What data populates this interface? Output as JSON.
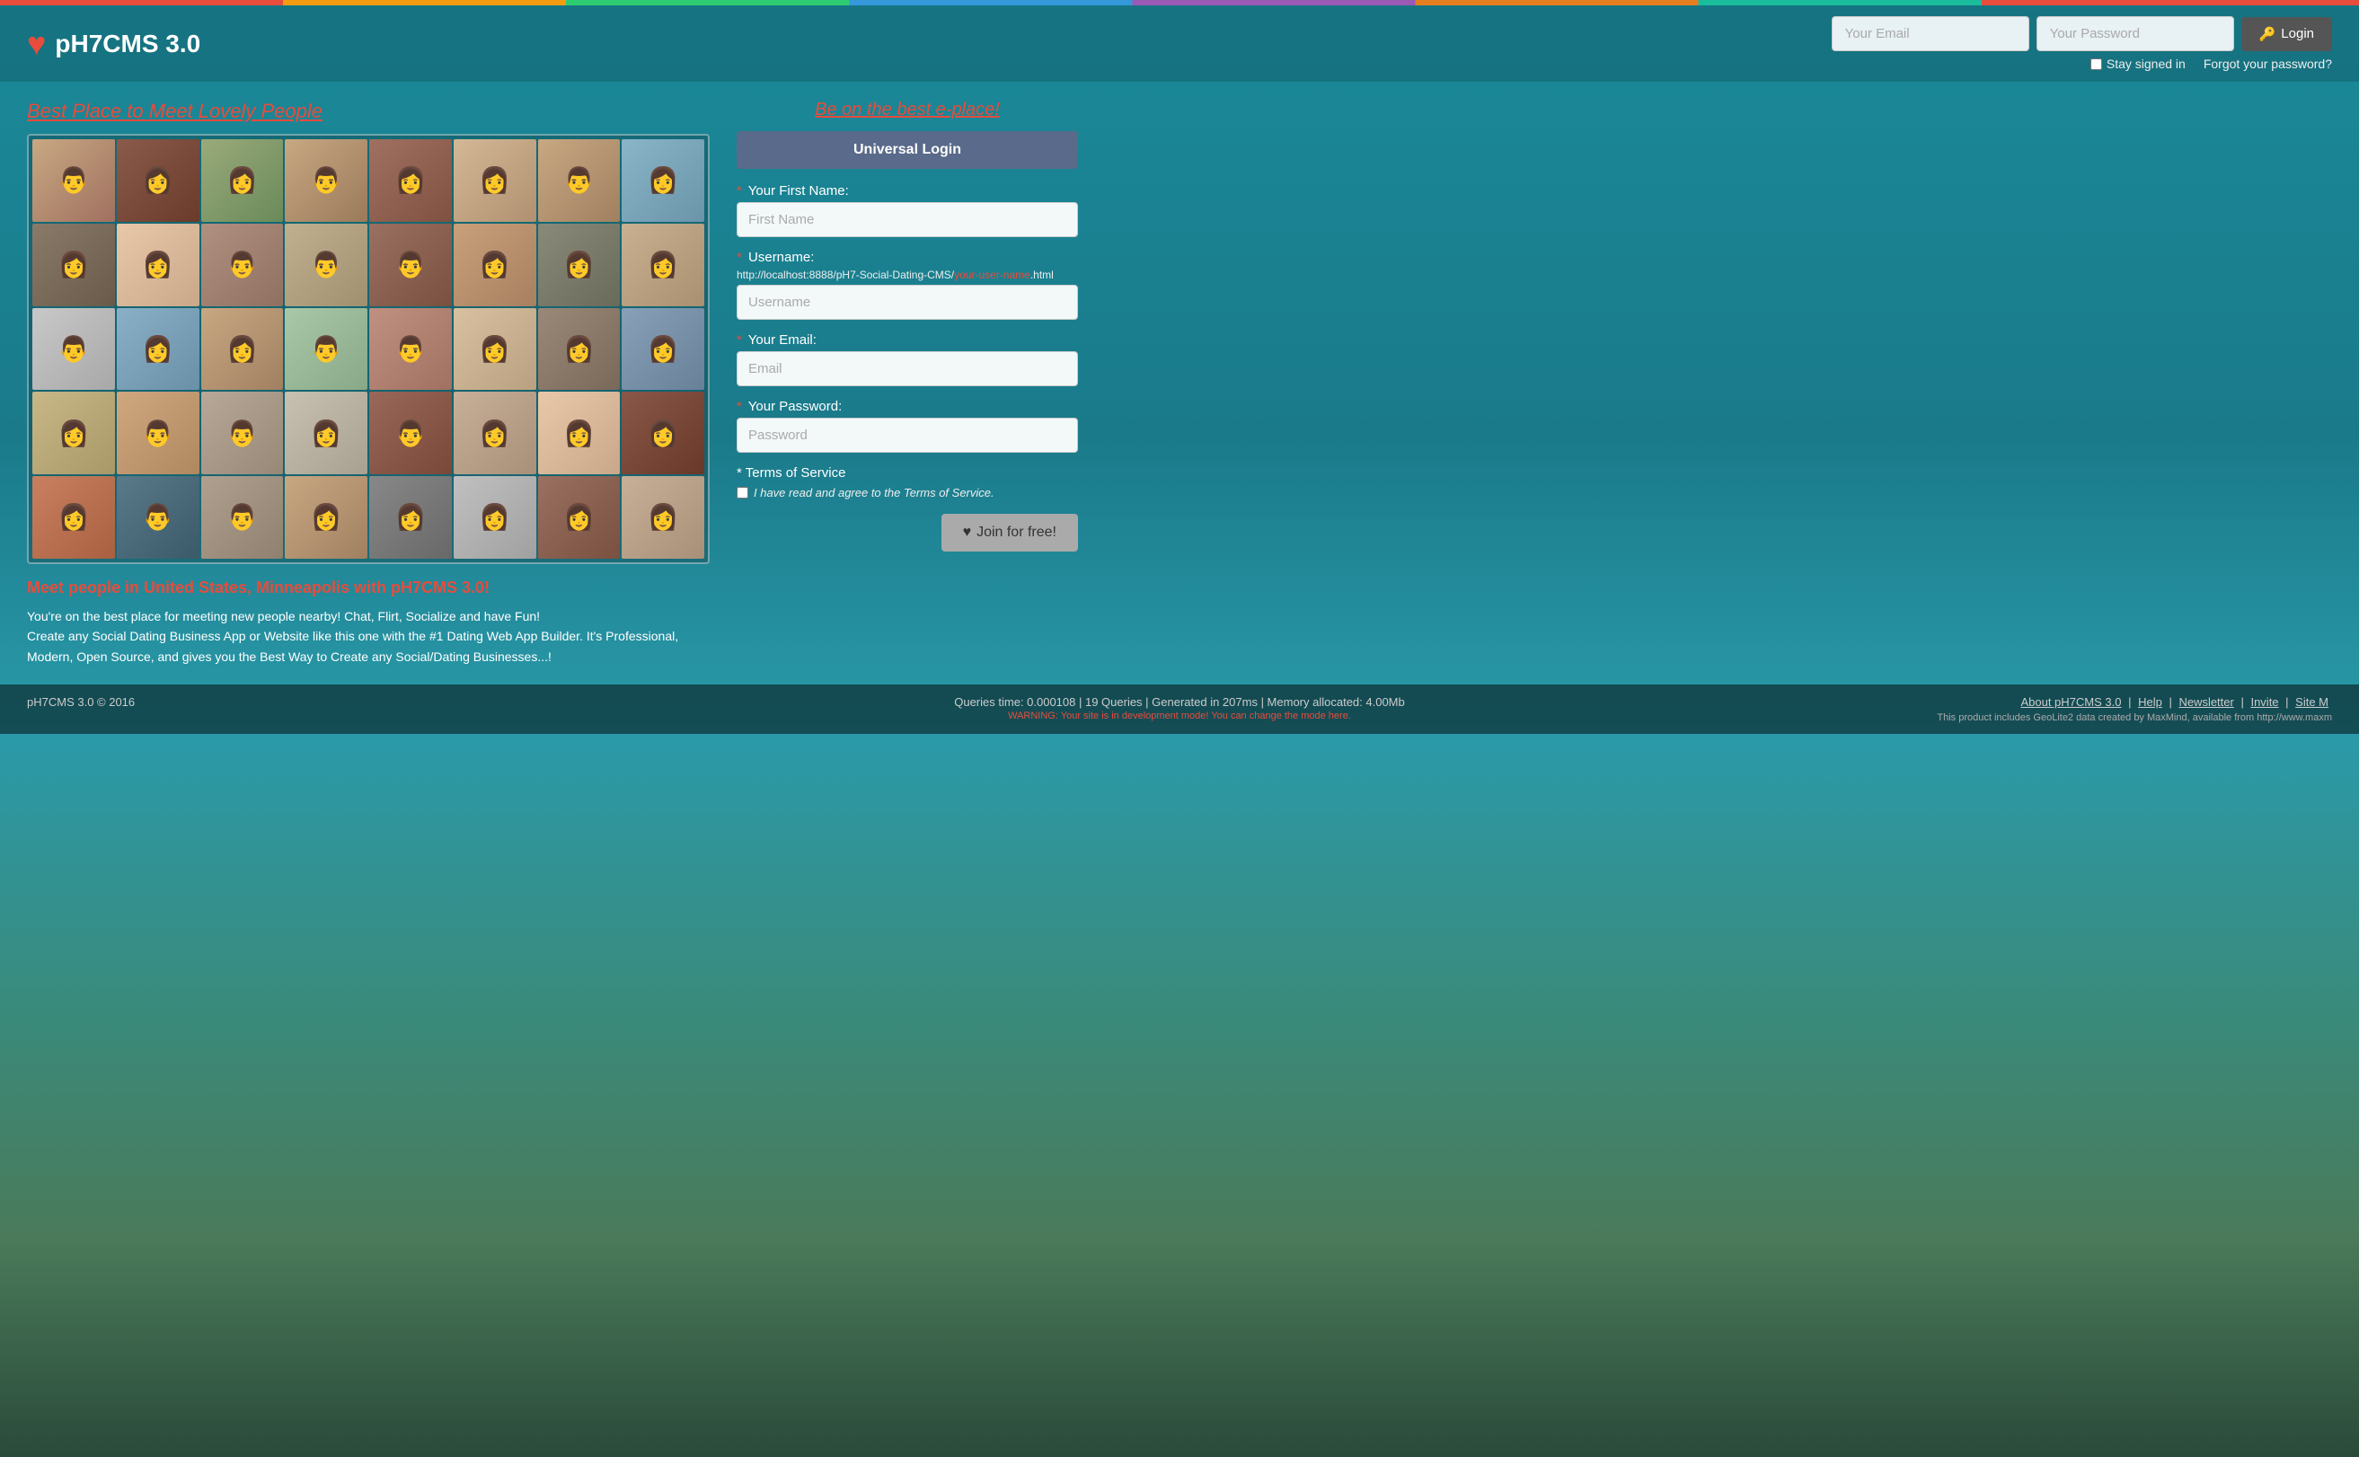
{
  "colorbar": {
    "label": "color-bar"
  },
  "header": {
    "logo_heart": "♥",
    "logo_text": "pH7CMS 3.0",
    "email_placeholder": "Your Email",
    "password_placeholder": "Your Password",
    "login_label": "Login",
    "stay_signed_label": "Stay signed in",
    "forgot_password_label": "Forgot your password?"
  },
  "left": {
    "best_place_link": "Best Place to Meet Lovely People",
    "promo_title": "Meet people in United States, Minneapolis with pH7CMS 3.0!",
    "promo_text": "You're on the best place for meeting new people nearby! Chat, Flirt, Socialize and have Fun!\nCreate any Social Dating Business App or Website like this one with the #1 Dating Web App Builder. It's Professional, Modern, Open Source, and gives you the Best Way to Create any Social/Dating Businesses...!"
  },
  "right": {
    "be_on_best_label": "Be on the best e-place!",
    "universal_login_label": "Universal Login",
    "first_name_label": "Your First Name:",
    "first_name_placeholder": "First Name",
    "username_label": "Username:",
    "username_hint": "http://localhost:8888/pH7-Social-Dating-CMS/",
    "username_hint_var": "your-user-name",
    "username_hint_end": ".html",
    "username_placeholder": "Username",
    "email_label": "Your Email:",
    "email_placeholder": "Email",
    "password_label": "Your Password:",
    "password_placeholder": "Password",
    "terms_label": "Terms of Service",
    "terms_checkbox_label": "I have read and agree to the Terms of Service.",
    "join_label": "Join for free!",
    "join_heart": "♥"
  },
  "footer": {
    "copyright": "pH7CMS 3.0 © 2016",
    "stats": "Queries time: 0.000108 | 19 Queries | Generated in 207ms | Memory allocated: 4.00Mb",
    "warning": "WARNING: Your site is in development mode! You can change the mode here.",
    "about": "About pH7CMS 3.0",
    "help": "Help",
    "newsletter": "Newsletter",
    "invite": "Invite",
    "site": "Site M",
    "geo": "This product includes GeoLite2 data created by MaxMind, available from http://www.maxm"
  },
  "avatars": [
    {
      "color1": "#c8a882",
      "color2": "#a07060",
      "icon": "👨"
    },
    {
      "color1": "#8a5a4a",
      "color2": "#6a3a2a",
      "icon": "👩"
    },
    {
      "color1": "#9aaa7a",
      "color2": "#6a8a5a",
      "icon": "👩"
    },
    {
      "color1": "#c8a882",
      "color2": "#9a7a5a",
      "icon": "👨"
    },
    {
      "color1": "#a07060",
      "color2": "#805040",
      "icon": "👩"
    },
    {
      "color1": "#d4b896",
      "color2": "#b09070",
      "icon": "👩"
    },
    {
      "color1": "#c8a882",
      "color2": "#a08060",
      "icon": "👨"
    },
    {
      "color1": "#8ab4c8",
      "color2": "#6a94a8",
      "icon": "👩"
    },
    {
      "color1": "#8a7a6a",
      "color2": "#6a5a4a",
      "icon": "👩"
    },
    {
      "color1": "#e8c8a8",
      "color2": "#c8a888",
      "icon": "👩"
    },
    {
      "color1": "#b09080",
      "color2": "#907060",
      "icon": "👨"
    },
    {
      "color1": "#c0b090",
      "color2": "#a09070",
      "icon": "👨"
    },
    {
      "color1": "#9a7060",
      "color2": "#7a5040",
      "icon": "👨"
    },
    {
      "color1": "#c8a07a",
      "color2": "#a88060",
      "icon": "👩"
    },
    {
      "color1": "#8a8a7a",
      "color2": "#6a6a5a",
      "icon": "👩"
    },
    {
      "color1": "#c8b090",
      "color2": "#a89070",
      "icon": "👩"
    },
    {
      "color1": "#c8c8c8",
      "color2": "#a8a8a8",
      "icon": "👨"
    },
    {
      "color1": "#8ab0c8",
      "color2": "#6a90a8",
      "icon": "👩"
    },
    {
      "color1": "#c8a882",
      "color2": "#a08060",
      "icon": "👩"
    },
    {
      "color1": "#a8c8a8",
      "color2": "#88a888",
      "icon": "👨"
    },
    {
      "color1": "#c09080",
      "color2": "#a07060",
      "icon": "👨"
    },
    {
      "color1": "#d8c0a0",
      "color2": "#b8a080",
      "icon": "👩"
    },
    {
      "color1": "#9a8878",
      "color2": "#7a6858",
      "icon": "👩"
    },
    {
      "color1": "#88a0b8",
      "color2": "#688098",
      "icon": "👩"
    },
    {
      "color1": "#c8b888",
      "color2": "#a89868",
      "icon": "👩"
    },
    {
      "color1": "#d0a880",
      "color2": "#b08860",
      "icon": "👨"
    },
    {
      "color1": "#b8a898",
      "color2": "#988878",
      "icon": "👨"
    },
    {
      "color1": "#c8c0b0",
      "color2": "#a8a090",
      "icon": "👩"
    },
    {
      "color1": "#9a6858",
      "color2": "#7a4838",
      "icon": "👨"
    },
    {
      "color1": "#c8b098",
      "color2": "#a89078",
      "icon": "👩"
    },
    {
      "color1": "#e8c8a8",
      "color2": "#c8a888",
      "icon": "👩"
    },
    {
      "color1": "#8a5848",
      "color2": "#6a3828",
      "icon": "👩"
    },
    {
      "color1": "#c88060",
      "color2": "#a86040",
      "icon": "👩"
    },
    {
      "color1": "#5a7a8a",
      "color2": "#3a5a6a",
      "icon": "👨"
    },
    {
      "color1": "#b0a090",
      "color2": "#908070",
      "icon": "👨"
    },
    {
      "color1": "#c8a882",
      "color2": "#a08060",
      "icon": "👩"
    },
    {
      "color1": "#888888",
      "color2": "#686868",
      "icon": "👩"
    },
    {
      "color1": "#c0c0c0",
      "color2": "#a0a0a0",
      "icon": "👩"
    },
    {
      "color1": "#9a7060",
      "color2": "#7a5040",
      "icon": "👩"
    },
    {
      "color1": "#c8b098",
      "color2": "#a89078",
      "icon": "👩"
    }
  ]
}
